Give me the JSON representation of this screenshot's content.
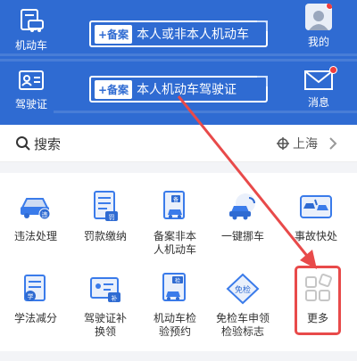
{
  "header": {
    "vehicle_label": "机动车",
    "license_label": "驾驶证",
    "mine_label": "我的",
    "messages_label": "消息",
    "banner_1": {
      "badge": "+备案",
      "text": "本人或非本人机动车"
    },
    "banner_2": {
      "badge": "+备案",
      "text": "本人机动车驾驶证"
    }
  },
  "search": {
    "label": "搜索",
    "city": "上海"
  },
  "services": [
    {
      "label_1": "违法处理",
      "label_2": ""
    },
    {
      "label_1": "罚款缴纳",
      "label_2": ""
    },
    {
      "label_1": "备案非本",
      "label_2": "人机动车"
    },
    {
      "label_1": "一键挪车",
      "label_2": ""
    },
    {
      "label_1": "事故快处",
      "label_2": ""
    },
    {
      "label_1": "学法减分",
      "label_2": ""
    },
    {
      "label_1": "驾驶证补",
      "label_2": "换领"
    },
    {
      "label_1": "机动车检",
      "label_2": "验预约"
    },
    {
      "label_1": "免检车申领",
      "label_2": "检验标志"
    },
    {
      "label_1": "更多",
      "label_2": ""
    }
  ],
  "icons": {
    "small_badges": [
      "违",
      "罚",
      "备",
      "挪",
      "事",
      "学",
      "补",
      "检",
      "免检"
    ]
  },
  "colors": {
    "header_blue": "#2f6bd2",
    "accent_blue": "#3a7bea",
    "annotation_red": "#e84a4a"
  }
}
